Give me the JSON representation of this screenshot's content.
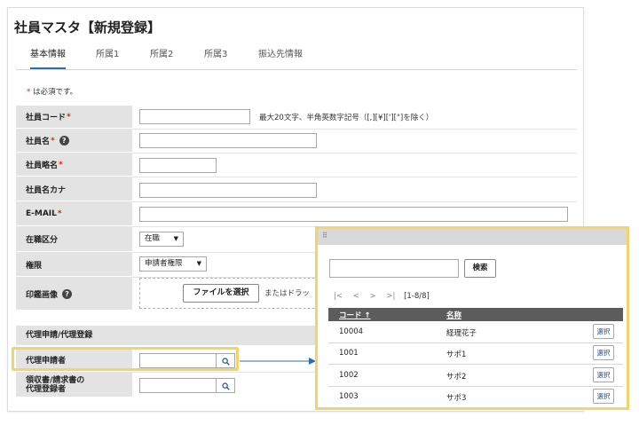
{
  "page": {
    "title": "社員マスタ【新規登録】"
  },
  "tabs": [
    {
      "label": "基本情報"
    },
    {
      "label": "所属1"
    },
    {
      "label": "所属2"
    },
    {
      "label": "所属3"
    },
    {
      "label": "振込先情報"
    }
  ],
  "required_note": {
    "asterisk": "*",
    "text": " は必須です。"
  },
  "fields": {
    "employee_code": {
      "label": "社員コード",
      "required": "*",
      "hint": "最大20文字、半角英数字記号（[,][¥]['][\"]を除く）"
    },
    "employee_name": {
      "label": "社員名",
      "required": "*"
    },
    "employee_short_name": {
      "label": "社員略名",
      "required": "*"
    },
    "employee_kana": {
      "label": "社員名カナ"
    },
    "email": {
      "label": "E-MAIL",
      "required": "*"
    },
    "employment_status": {
      "label": "在職区分",
      "value": "在職"
    },
    "authority": {
      "label": "権限",
      "value": "申請者権限"
    },
    "seal_image": {
      "label": "印鑑画像",
      "file_button": "ファイルを選択",
      "drop_text": "またはドラッ"
    },
    "proxy_section": {
      "label": "代理申請/代理登録"
    },
    "proxy_applicant": {
      "label": "代理申請者"
    },
    "receipt_proxy": {
      "label_line1": "領収書/請求書の",
      "label_line2": "代理登録者"
    }
  },
  "icons": {
    "help": "question-circle-icon",
    "search": "magnifier-icon",
    "drag": "grip-icon"
  },
  "popup": {
    "search_button": "検索",
    "pager": {
      "first": "|<",
      "prev": "<",
      "next": ">",
      "last": ">|",
      "count": "[1-8/8]"
    },
    "columns": {
      "code": "コード ↑",
      "name": "名称"
    },
    "rows": [
      {
        "code": "10004",
        "name": "経理花子",
        "select": "選択"
      },
      {
        "code": "1001",
        "name": "サポ1",
        "select": "選択"
      },
      {
        "code": "1002",
        "name": "サポ2",
        "select": "選択"
      },
      {
        "code": "1003",
        "name": "サポ3",
        "select": "選択"
      }
    ]
  },
  "colors": {
    "highlight": "#f5d26b",
    "label_bg": "#e3e3e3",
    "table_header": "#5c5c5c",
    "link_blue": "#2a6fb0"
  }
}
